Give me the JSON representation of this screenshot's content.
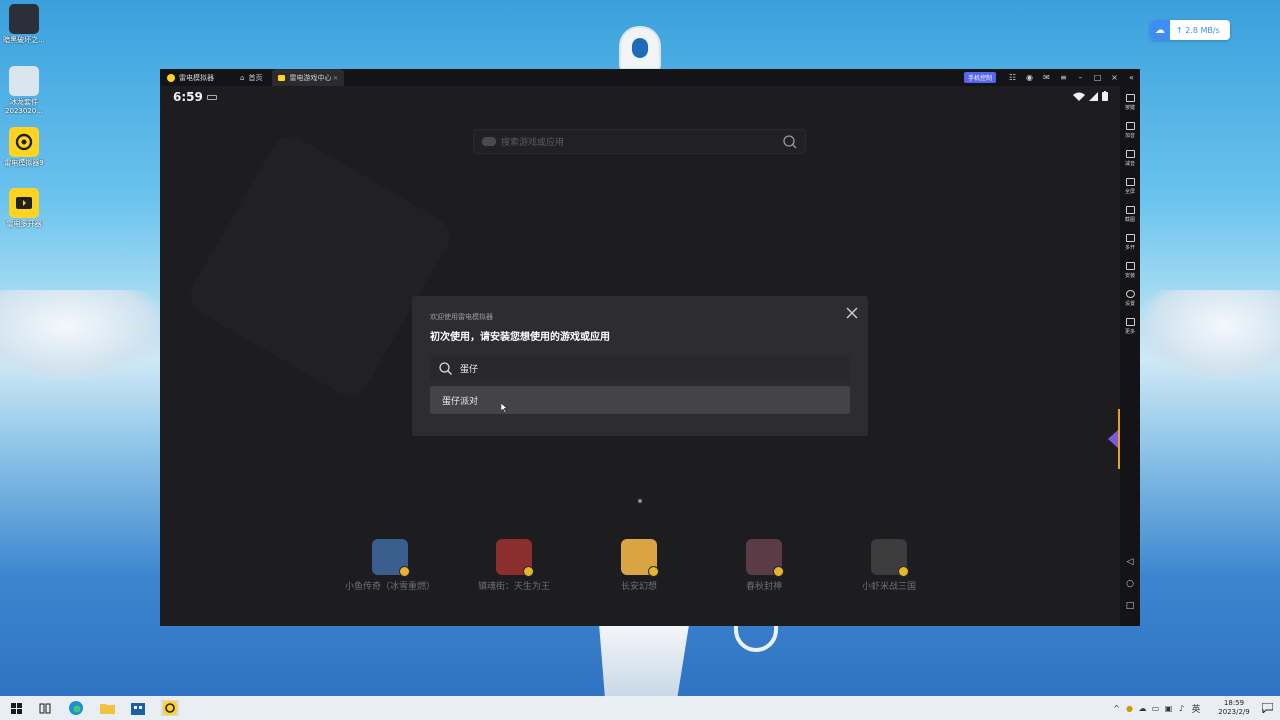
{
  "desktop": {
    "icons": [
      {
        "label": "暗黑破坏之...",
        "icon": "game-dark-icon",
        "color": "#2b2f3a"
      },
      {
        "label": "冰龙套件\n2023020...",
        "icon": "character-icon",
        "color": "#d9e6ef"
      },
      {
        "label": "雷电模拟器9",
        "icon": "ldplayer-icon",
        "color": "#ffd321"
      },
      {
        "label": "雷电多开器",
        "icon": "ldmulti-icon",
        "color": "#ffd321"
      }
    ],
    "net_speed": "↑ 2.8 MB/s"
  },
  "emulator": {
    "app_title": "雷电模拟器",
    "tabs": [
      {
        "label": "首页",
        "icon": "home-icon"
      },
      {
        "label": "雷电游戏中心",
        "icon": "gamecenter-icon"
      }
    ],
    "phone_control": "手机控制",
    "status_time": "6:59",
    "top_search_placeholder": "搜索游戏或应用",
    "dialog": {
      "subtitle": "欢迎使用雷电模拟器",
      "title": "初次使用，请安装您想使用的游戏或应用",
      "query": "蛋仔",
      "suggestion": "蛋仔派对"
    },
    "games": [
      {
        "name": "小鱼传奇（冰雪重燃）",
        "color": "#3a5f8f"
      },
      {
        "name": "镇魂街：天生为王",
        "color": "#8a2e2e"
      },
      {
        "name": "长安幻想",
        "color": "#d9a441"
      },
      {
        "name": "春秋封神",
        "color": "#5a3b46"
      },
      {
        "name": "小虾米战三国",
        "color": "#3c3c3c"
      }
    ],
    "sidebar": [
      {
        "label": "按键",
        "icon": "keyboard-icon"
      },
      {
        "label": "加音",
        "icon": "volume-up-icon"
      },
      {
        "label": "减音",
        "icon": "volume-down-icon"
      },
      {
        "label": "全屏",
        "icon": "fullscreen-icon"
      },
      {
        "label": "截图",
        "icon": "scissors-icon"
      },
      {
        "label": "多开",
        "icon": "multi-instance-icon"
      },
      {
        "label": "安装",
        "icon": "install-icon"
      },
      {
        "label": "设置",
        "icon": "settings-icon"
      },
      {
        "label": "更多",
        "icon": "more-icon"
      }
    ],
    "nav": {
      "back": "◁",
      "home": "○",
      "recent": "□"
    }
  },
  "taskbar": {
    "ime": "英",
    "time": "18:59",
    "date": "2023/2/9"
  },
  "colors": {
    "accent_purple": "#5865f2",
    "ld_yellow": "#ffd321"
  }
}
